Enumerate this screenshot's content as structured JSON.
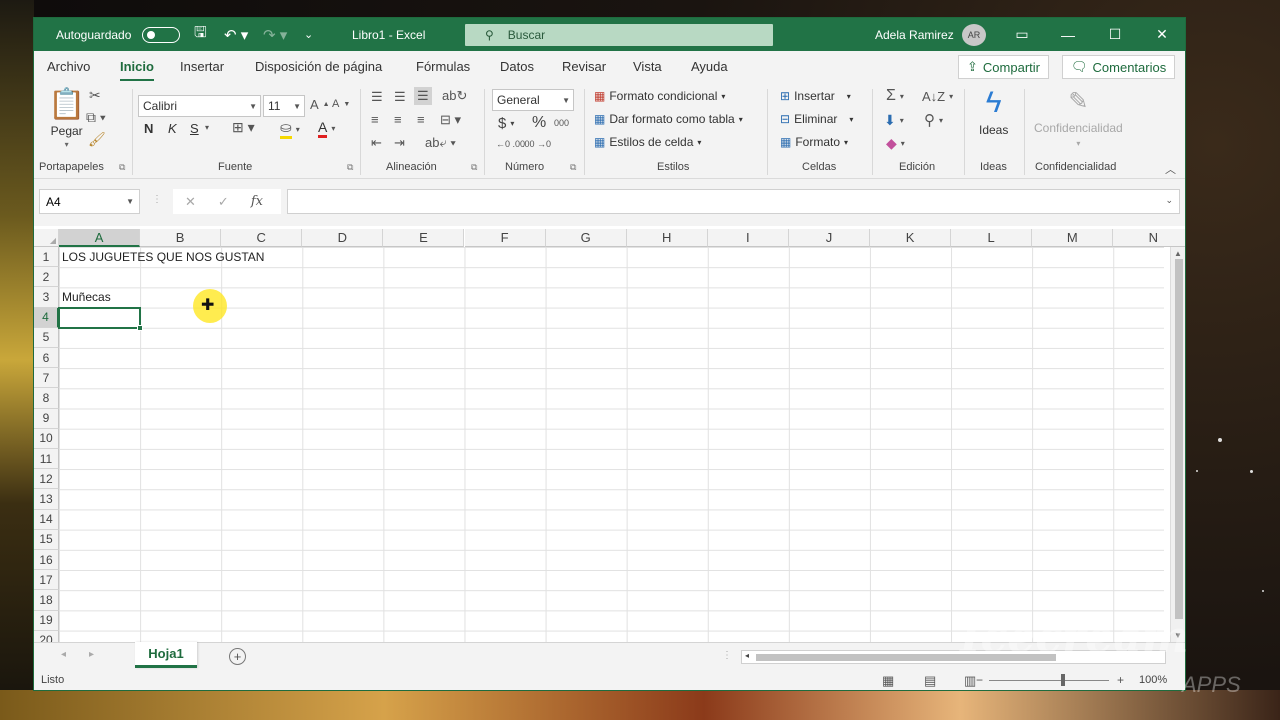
{
  "titlebar": {
    "autosave_label": "Autoguardado",
    "document_title": "Libro1  -  Excel",
    "search_placeholder": "Buscar",
    "user_name": "Adela Ramirez",
    "user_initials": "AR"
  },
  "menu": {
    "tabs": [
      "Archivo",
      "Inicio",
      "Insertar",
      "Disposición de página",
      "Fórmulas",
      "Datos",
      "Revisar",
      "Vista",
      "Ayuda"
    ],
    "active_tab": "Inicio",
    "share_label": "Compartir",
    "comments_label": "Comentarios"
  },
  "ribbon": {
    "clipboard": {
      "paste_label": "Pegar",
      "group_label": "Portapapeles"
    },
    "font": {
      "font_name": "Calibri",
      "font_size": "11",
      "bold": "N",
      "italic": "K",
      "underline": "S",
      "group_label": "Fuente",
      "accent_fill": "#f5d800",
      "accent_font": "#e02020"
    },
    "alignment": {
      "group_label": "Alineación"
    },
    "number": {
      "format": "General",
      "currency": "$",
      "percent": "%",
      "thousands": "000",
      "group_label": "Número"
    },
    "styles": {
      "conditional": "Formato condicional",
      "as_table": "Dar formato como tabla",
      "cell_styles": "Estilos de celda",
      "group_label": "Estilos"
    },
    "cells": {
      "insert": "Insertar",
      "delete": "Eliminar",
      "format": "Formato",
      "group_label": "Celdas"
    },
    "editing": {
      "group_label": "Edición"
    },
    "ideas": {
      "label": "Ideas",
      "group_label": "Ideas"
    },
    "sensitivity": {
      "label": "Confidencialidad",
      "group_label": "Confidencialidad"
    }
  },
  "formula_bar": {
    "name_box": "A4",
    "fx": "fx",
    "content": ""
  },
  "sheet": {
    "columns": [
      "A",
      "B",
      "C",
      "D",
      "E",
      "F",
      "G",
      "H",
      "I",
      "J",
      "K",
      "L",
      "M",
      "N"
    ],
    "rows": [
      "1",
      "2",
      "3",
      "4",
      "5",
      "6",
      "7",
      "8",
      "9",
      "10",
      "11",
      "12",
      "13",
      "14",
      "15",
      "16",
      "17",
      "18",
      "19",
      "20"
    ],
    "selected_column": "A",
    "selected_row": "4",
    "cells": {
      "A1": "LOS JUGUETES QUE NOS GUSTAN",
      "A3": "Muñecas"
    }
  },
  "sheet_tabs": {
    "active": "Hoja1"
  },
  "status": {
    "text": "Listo",
    "zoom": "100%"
  },
  "watermark": {
    "text": "Icecream",
    "sub": "APPS"
  },
  "colors": {
    "excel_green": "#217346",
    "accent_green": "#1e6b3d"
  }
}
